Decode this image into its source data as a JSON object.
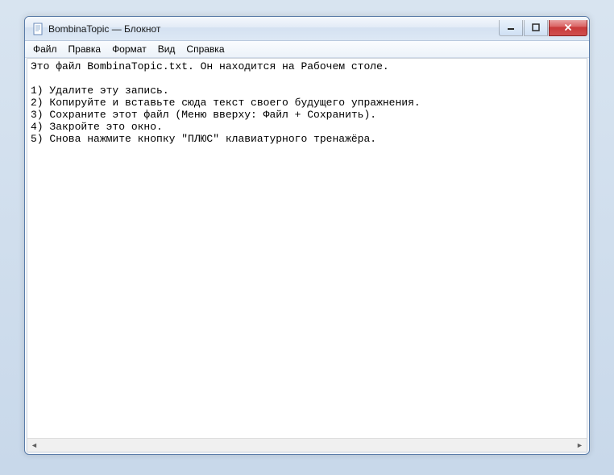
{
  "window": {
    "title": "BombinaTopic — Блокнот"
  },
  "menu": {
    "file": "Файл",
    "edit": "Правка",
    "format": "Формат",
    "view": "Вид",
    "help": "Справка"
  },
  "content": {
    "text": "Это файл BombinaTopic.txt. Он находится на Рабочем столе.\n\n1) Удалите эту запись.\n2) Копируйте и вставьте сюда текст своего будущего упражнения.\n3) Сохраните этот файл (Меню вверху: Файл + Сохранить).\n4) Закройте это окно.\n5) Снова нажмите кнопку \"ПЛЮС\" клавиатурного тренажёра."
  }
}
